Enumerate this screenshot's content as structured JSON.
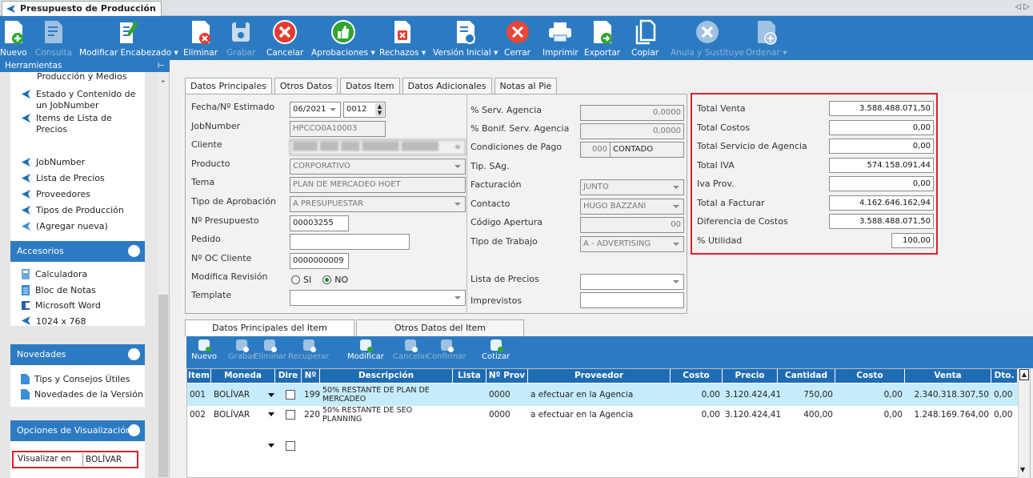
{
  "window": {
    "tab_title": "Presupuesto de Producción",
    "corner": "◁ ▷"
  },
  "toolbar": [
    {
      "label": "Nuevo",
      "icon": "new-doc-icon",
      "enabled": true
    },
    {
      "label": "Consulta",
      "icon": "query-doc-icon",
      "enabled": false
    },
    {
      "label": "Modificar Encabezado ▾",
      "icon": "edit-header-icon",
      "enabled": true
    },
    {
      "label": "Eliminar",
      "icon": "delete-doc-icon",
      "enabled": true
    },
    {
      "label": "Grabar",
      "icon": "save-icon",
      "enabled": false
    },
    {
      "label": "Cancelar",
      "icon": "cancel-icon",
      "enabled": true
    },
    {
      "label": "Aprobaciones ▾",
      "icon": "thumbs-up-icon",
      "enabled": true
    },
    {
      "label": "Rechazos ▾",
      "icon": "reject-doc-icon",
      "enabled": true
    },
    {
      "label": "Versión Inicial ▾",
      "icon": "version-icon",
      "enabled": true
    },
    {
      "label": "Cerrar",
      "icon": "close-circle-icon",
      "enabled": true
    },
    {
      "label": "Imprimir",
      "icon": "printer-icon",
      "enabled": true
    },
    {
      "label": "Exportar",
      "icon": "export-icon",
      "enabled": true
    },
    {
      "label": "Copiar",
      "icon": "copy-icon",
      "enabled": true
    },
    {
      "label": "Anula y Sustituye",
      "icon": "annul-icon",
      "enabled": false
    },
    {
      "label": "Ordenar ▾",
      "icon": "sort-icon",
      "enabled": false
    }
  ],
  "sidebar": {
    "header": "Herramientas",
    "pin": "⊢",
    "tools": [
      "Producción y Medios",
      "Estado y Contenido de un JobNumber",
      "Items de Lista de Precios",
      "JobNumber",
      "Lista de Precios",
      "Proveedores",
      "Tipos de Producción",
      "(Agregar nueva)"
    ],
    "accesorios_title": "Accesorios",
    "accesorios": [
      "Calculadora",
      "Bloc de Notas",
      "Microsoft Word",
      "1024 x 768"
    ],
    "novedades_title": "Novedades",
    "novedades": [
      "Tips y Consejos Útiles",
      "Novedades de la Versión"
    ],
    "opciones_title": "Opciones de Visualización",
    "visualizar_label": "Visualizar en",
    "visualizar_value": "BOLÍVAR"
  },
  "header_tabs": [
    "Datos Principales",
    "Otros Datos",
    "Datos Item",
    "Datos Adicionales",
    "Notas al Pie"
  ],
  "form": {
    "fecha_label": "Fecha/Nº Estimado",
    "fecha_value": "06/2021",
    "estimado_value": "0012",
    "jobnumber_label": "JobNumber",
    "jobnumber_value": "HPCCO0A10003",
    "cliente_label": "Cliente",
    "cliente_value": "████ ███ ███ ██████ ██████",
    "producto_label": "Producto",
    "producto_value": "CORPORATIVO",
    "tema_label": "Tema",
    "tema_value": "PLAN DE MERCADEO HOET",
    "tipo_aprob_label": "Tipo de Aprobación",
    "tipo_aprob_value": "A PRESUPUESTAR",
    "presupuesto_label": "Nº Presupuesto",
    "presupuesto_value": "00003255",
    "pedido_label": "Pedido",
    "pedido_value": "",
    "oc_label": "Nº OC Cliente",
    "oc_value": "0000000009",
    "mod_rev_label": "Modifica Revisión",
    "mod_si": "SI",
    "mod_no": "NO",
    "template_label": "Template",
    "template_value": ""
  },
  "form2": {
    "serv_label": "% Serv. Agencia",
    "serv_value": "0,0000",
    "bonif_label": "% Bonif. Serv. Agencia",
    "bonif_value": "0,0000",
    "cond_label": "Condiciones de Pago",
    "cond_code": "000",
    "cond_value": "CONTADO",
    "tipsag_label": "Tip. SAg.",
    "fact_label": "Facturación",
    "fact_value": "JUNTO",
    "contacto_label": "Contacto",
    "contacto_value": "HUGO BAZZANI",
    "codigo_label": "Código Apertura",
    "codigo_value": "00",
    "trabajo_label": "Tipo de Trabajo",
    "trabajo_value": "A - ADVERTISING",
    "lista_label": "Lista de Precios",
    "lista_value": "",
    "imprev_label": "Imprevistos",
    "imprev_value": ""
  },
  "totals": [
    {
      "label": "Total Venta",
      "value": "3.588.488.071,50"
    },
    {
      "label": "Total Costos",
      "value": "0,00"
    },
    {
      "label": "Total Servicio de Agencia",
      "value": "0,00"
    },
    {
      "label": "Total IVA",
      "value": "574.158.091,44"
    },
    {
      "label": "Iva Prov.",
      "value": "0,00"
    },
    {
      "label": "Total a Facturar",
      "value": "4.162.646.162,94"
    },
    {
      "label": "Diferencia de Costos",
      "value": "3.588.488.071,50"
    },
    {
      "label": "% Utilidad",
      "value": "100,00"
    }
  ],
  "item_tabs": [
    "Datos Principales del Item",
    "Otros Datos del Item"
  ],
  "item_toolbar": [
    {
      "label": "Nuevo",
      "enabled": true
    },
    {
      "label": "Grabar",
      "enabled": false
    },
    {
      "label": "Eliminar",
      "enabled": false
    },
    {
      "label": "Recuperar",
      "enabled": false
    },
    {
      "label": "Modificar",
      "enabled": true
    },
    {
      "label": "Cancelar",
      "enabled": false
    },
    {
      "label": "Confirmar",
      "enabled": false
    },
    {
      "label": "Cotizar",
      "enabled": true
    }
  ],
  "grid": {
    "columns": [
      "Item",
      "Moneda",
      "Dire",
      "Nº",
      "Descripción",
      "Lista",
      "Nº Prov",
      "Proveedor",
      "Costo Unit.",
      "Precio Unit.",
      "Cantidad",
      "Costo",
      "Venta",
      "Dto."
    ],
    "rows": [
      {
        "item": "001",
        "moneda": "BOLÍVAR",
        "num": "199",
        "desc": "50% RESTANTE DE PLAN DE MERCADEO",
        "lista": "",
        "nprov": "0000",
        "prov": "a efectuar en la Agencia",
        "costo_unit": "0,00",
        "precio_unit": "3.120.424,41",
        "cantidad": "750,00",
        "costo": "0,00",
        "venta": "2.340.318.307,50",
        "dto": "0,00"
      },
      {
        "item": "002",
        "moneda": "BOLÍVAR",
        "num": "220",
        "desc": "50% RESTANTE DE SEO PLANNING",
        "lista": "",
        "nprov": "0000",
        "prov": "a efectuar en la Agencia",
        "costo_unit": "0,00",
        "precio_unit": "3.120.424,41",
        "cantidad": "400,00",
        "costo": "0,00",
        "venta": "1.248.169.764,00",
        "dto": "0,00"
      }
    ]
  },
  "colors": {
    "accent": "#2c7bc2",
    "highlight_border": "#e0202a",
    "selected_row": "#c6ecfb",
    "grid_header": "#1e6cb3"
  }
}
